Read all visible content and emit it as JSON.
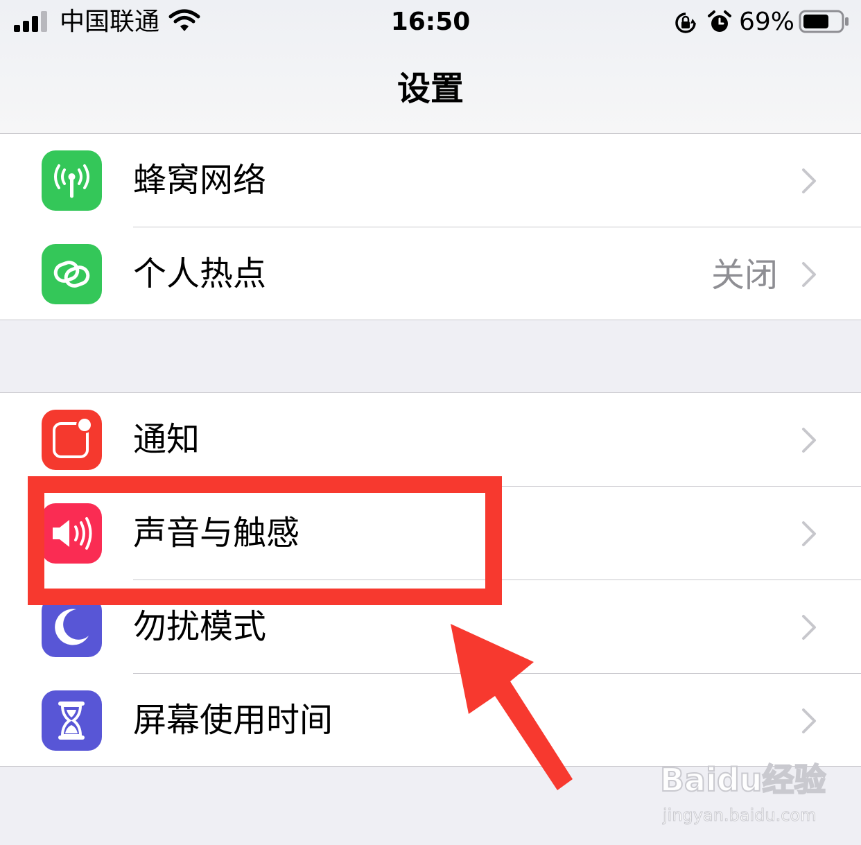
{
  "status_bar": {
    "carrier": "中国联通",
    "time": "16:50",
    "battery_percent": "69%",
    "battery_level": 0.69,
    "icons": [
      "signal-icon",
      "wifi-icon",
      "orientation-lock-icon",
      "alarm-icon",
      "battery-icon"
    ]
  },
  "nav": {
    "title": "设置"
  },
  "groups": [
    {
      "items": [
        {
          "label": "蜂窝网络",
          "icon": "cellular-antenna-icon",
          "icon_color": "#34c759",
          "value": ""
        },
        {
          "label": "个人热点",
          "icon": "hotspot-link-icon",
          "icon_color": "#34c759",
          "value": "关闭"
        }
      ]
    },
    {
      "items": [
        {
          "label": "通知",
          "icon": "notifications-icon",
          "icon_color": "#f5392e",
          "value": ""
        },
        {
          "label": "声音与触感",
          "icon": "speaker-icon",
          "icon_color": "#fa2c53",
          "value": ""
        },
        {
          "label": "勿扰模式",
          "icon": "moon-icon",
          "icon_color": "#5856d6",
          "value": ""
        },
        {
          "label": "屏幕使用时间",
          "icon": "hourglass-icon",
          "icon_color": "#5856d6",
          "value": ""
        }
      ]
    }
  ],
  "annotation": {
    "color": "#f7392f",
    "highlighted_item": "声音与触感"
  },
  "watermark": {
    "brand": "Baidu经验",
    "url": "jingyan.baidu.com"
  }
}
